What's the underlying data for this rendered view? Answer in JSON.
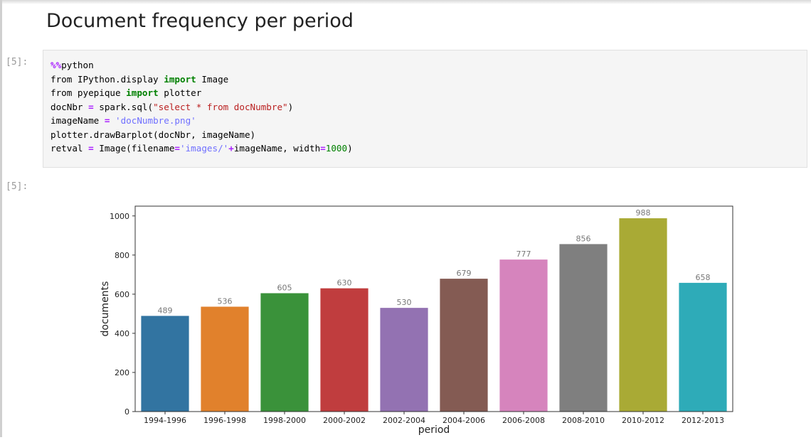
{
  "notebook": {
    "heading": "Document frequency per period",
    "input_prompt": "[5]:",
    "output_prompt": "[5]:",
    "code_lines": [
      [
        {
          "t": "%%",
          "c": "magic"
        },
        {
          "t": "python",
          "c": ""
        }
      ],
      [
        {
          "t": "from IPython.display ",
          "c": ""
        },
        {
          "t": "import",
          "c": "kw"
        },
        {
          "t": " Image",
          "c": ""
        }
      ],
      [
        {
          "t": "from pyepique ",
          "c": ""
        },
        {
          "t": "import",
          "c": "kw"
        },
        {
          "t": " plotter",
          "c": ""
        }
      ],
      [
        {
          "t": "docNbr ",
          "c": ""
        },
        {
          "t": "=",
          "c": "op"
        },
        {
          "t": " spark.sql(",
          "c": ""
        },
        {
          "t": "\"select * from docNumbre\"",
          "c": "str"
        },
        {
          "t": ")",
          "c": ""
        }
      ],
      [
        {
          "t": "imageName ",
          "c": ""
        },
        {
          "t": "=",
          "c": "op"
        },
        {
          "t": " ",
          "c": ""
        },
        {
          "t": "'docNumbre.png'",
          "c": "str2"
        }
      ],
      [
        {
          "t": "plotter.drawBarplot(docNbr, imageName)",
          "c": ""
        }
      ],
      [
        {
          "t": "retval ",
          "c": ""
        },
        {
          "t": "=",
          "c": "op"
        },
        {
          "t": " Image(filename",
          "c": ""
        },
        {
          "t": "=",
          "c": "op"
        },
        {
          "t": "'images/'",
          "c": "str2"
        },
        {
          "t": "+",
          "c": "op"
        },
        {
          "t": "imageName, width",
          "c": ""
        },
        {
          "t": "=",
          "c": "op"
        },
        {
          "t": "1000",
          "c": "num"
        },
        {
          "t": ")",
          "c": ""
        }
      ]
    ]
  },
  "chart_data": {
    "type": "bar",
    "categories": [
      "1994-1996",
      "1996-1998",
      "1998-2000",
      "2000-2002",
      "2002-2004",
      "2004-2006",
      "2006-2008",
      "2008-2010",
      "2010-2012",
      "2012-2013"
    ],
    "values": [
      489,
      536,
      605,
      630,
      530,
      679,
      777,
      856,
      988,
      658
    ],
    "colors": [
      "#3274a1",
      "#e1812c",
      "#3a923a",
      "#c03d3e",
      "#9372b2",
      "#845b53",
      "#d684bd",
      "#7f7f7f",
      "#a9aa35",
      "#2eabb8"
    ],
    "xlabel": "period",
    "ylabel": "documents",
    "ylim": [
      0,
      1000
    ],
    "yticks": [
      0,
      200,
      400,
      600,
      800,
      1000
    ],
    "value_labels": true,
    "grid": false
  }
}
